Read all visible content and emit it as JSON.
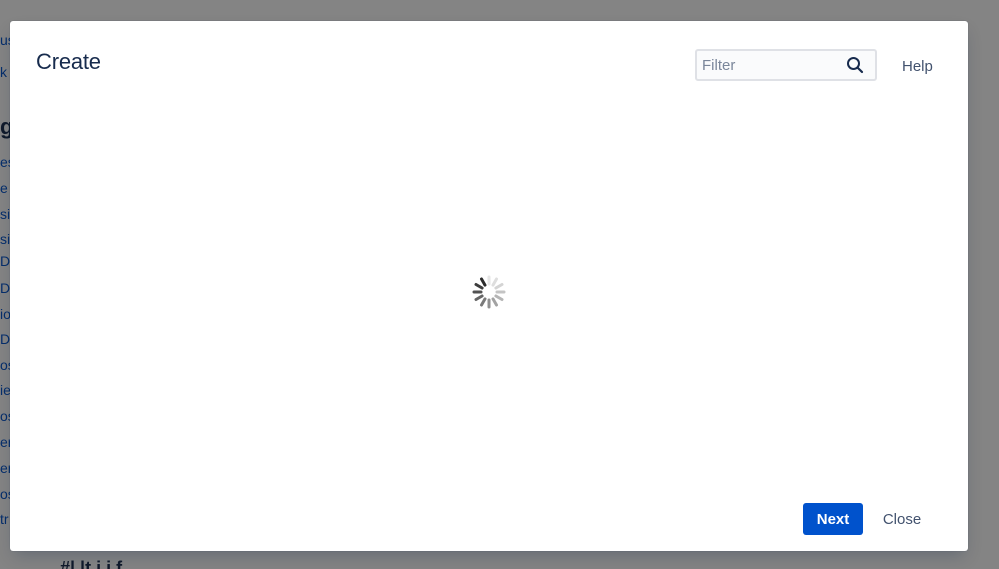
{
  "background": {
    "link_fragments": [
      "us",
      "k",
      "es",
      "e",
      "si",
      "si",
      "Do",
      "Do",
      "io",
      "D",
      "os",
      "ie",
      "os",
      "er",
      "er",
      "os",
      "tr"
    ],
    "heading_fragment": "gh",
    "bottom_text": "#| |t i   i f"
  },
  "dialog": {
    "title": "Create",
    "filter": {
      "placeholder": "Filter",
      "value": ""
    },
    "help_label": "Help",
    "loading_icon": "spinner-icon",
    "next_label": "Next",
    "close_label": "Close"
  },
  "colors": {
    "primary_button": "#0052cc",
    "title_text": "#172b4d",
    "secondary_text": "#42526e",
    "overlay": "#7f7f7f"
  }
}
